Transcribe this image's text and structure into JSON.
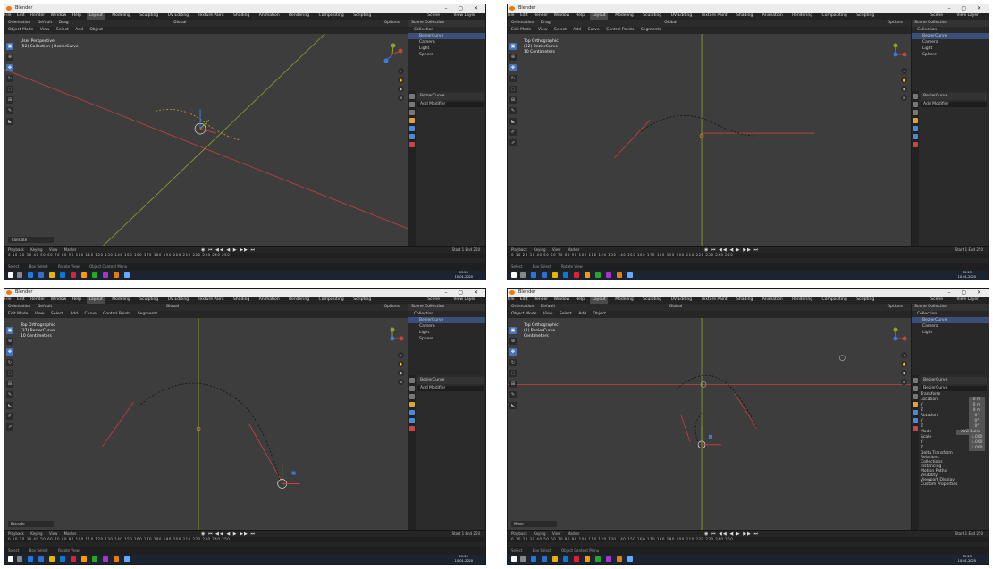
{
  "app": {
    "title": "Blender",
    "menus": [
      "File",
      "Edit",
      "Render",
      "Window",
      "Help"
    ],
    "workspaces": [
      "Layout",
      "Modeling",
      "Sculpting",
      "UV Editing",
      "Texture Paint",
      "Shading",
      "Animation",
      "Rendering",
      "Compositing",
      "Scripting"
    ],
    "active_workspace": "Layout",
    "scene": "Scene",
    "view_layer": "View Layer",
    "window_controls": "–  ▢  ✕"
  },
  "toolheader": {
    "orientation_label": "Orientation",
    "orientation_value": "Default",
    "drag_label": "Drag",
    "transform": "Global",
    "options": "Options"
  },
  "viewport_header": {
    "object_mode": [
      "Object Mode",
      "View",
      "Select",
      "Add",
      "Object"
    ],
    "edit_mode": [
      "Edit Mode",
      "View",
      "Select",
      "Add",
      "Curve",
      "Control Points",
      "Segments"
    ]
  },
  "outliner": {
    "title": "Scene Collection",
    "items": [
      {
        "label": "Collection",
        "level": 1
      },
      {
        "label": "BezierCurve",
        "level": 2
      },
      {
        "label": "Camera",
        "level": 2
      },
      {
        "label": "Light",
        "level": 2
      },
      {
        "label": "Sphere",
        "level": 2
      }
    ]
  },
  "properties": {
    "object_name": "BezierCurve",
    "field": "Add Modifier",
    "transform_title": "Transform",
    "location_label": "Location",
    "rotation_label": "Rotation",
    "mode_label": "Mode",
    "mode_value": "XYZ Euler",
    "scale_label": "Scale",
    "location": [
      "0 m",
      "0 m",
      "0 m"
    ],
    "rotation": [
      "0°",
      "0°",
      "0°"
    ],
    "scale": [
      "1.000",
      "1.000",
      "1.000"
    ],
    "axes": [
      "X",
      "Y",
      "Z"
    ],
    "sections": [
      "Delta Transform",
      "Relations",
      "Collections",
      "Instancing",
      "Motion Paths",
      "Visibility",
      "Viewport Display",
      "Custom Properties"
    ]
  },
  "timeline": {
    "menus": [
      "Playback",
      "Keying",
      "View",
      "Marker"
    ],
    "ruler": "0 10 20 30 40 50 60 70 80 90 100 110 120 130 140 150 160 170 180 190 200 210 220 230 240 250",
    "controls": "◉ ⏮ ◀◀ ◀ ▶ ▶▶ ⏭",
    "start_label": "Start",
    "start": "1",
    "end_label": "End",
    "end": "250"
  },
  "statusbar": {
    "select": "Select",
    "box_select": "Box Select",
    "rotate_view": "Rotate View",
    "context_menu": "Object Context Menu"
  },
  "clock": {
    "time": "13:23",
    "date": "10-01-2020"
  },
  "screens": [
    {
      "id": "top-left",
      "view_name": "User Perspective",
      "view_context": "(52) Collection | BezierCurve",
      "operator": "Translate",
      "mode": "object"
    },
    {
      "id": "top-right",
      "view_name": "Top Orthographic",
      "view_context": "(52) BezierCurve",
      "view_scale": "10 Centimeters",
      "operator": "",
      "mode": "edit"
    },
    {
      "id": "bottom-left",
      "view_name": "Top Orthographic",
      "view_context": "(37) BezierCurve",
      "view_scale": "10 Centimeters",
      "operator": "Extrude",
      "mode": "edit"
    },
    {
      "id": "bottom-right",
      "view_name": "Top Orthographic",
      "view_context": "(1) BezierCurve",
      "view_scale": "Centimeters",
      "operator": "Move",
      "mode": "object"
    }
  ]
}
